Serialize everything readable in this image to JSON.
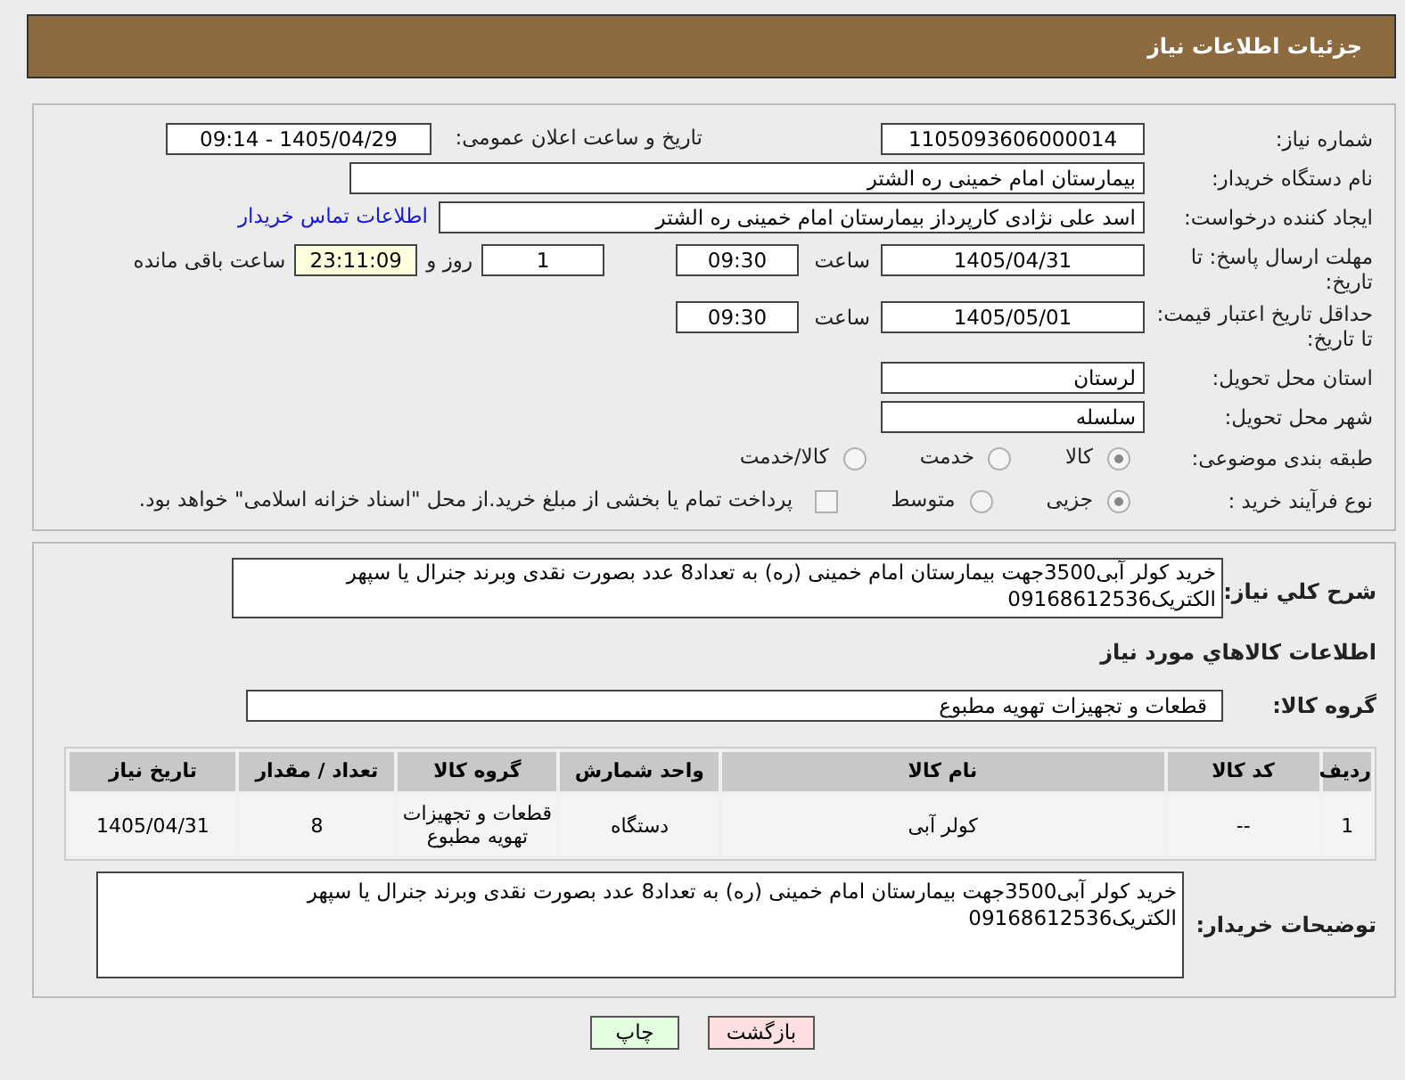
{
  "header": {
    "title": "جزئیات اطلاعات نیاز"
  },
  "need_number": {
    "label": "شماره نیاز:",
    "value": "1105093606000014"
  },
  "announce_datetime": {
    "label": "تاریخ و ساعت اعلان عمومی:",
    "value": "1405/04/29 - 09:14"
  },
  "buyer_org": {
    "label": "نام دستگاه خریدار:",
    "value": "بیمارستان امام خمینی ره الشتر"
  },
  "requester": {
    "label": "ایجاد کننده درخواست:",
    "value": "اسد علی نژادی کارپرداز بیمارستان امام خمینی ره الشتر",
    "link": "اطلاعات تماس خریدار"
  },
  "response_deadline": {
    "label": "مهلت ارسال پاسخ: تا تاریخ:",
    "date": "1405/04/31",
    "time_label": "ساعت",
    "time": "09:30",
    "days": "1",
    "days_label": "روز و",
    "remaining": "23:11:09",
    "remaining_label": "ساعت باقی مانده"
  },
  "price_validity": {
    "label": "حداقل تاریخ اعتبار قیمت: تا تاریخ:",
    "date": "1405/05/01",
    "time_label": "ساعت",
    "time": "09:30"
  },
  "province": {
    "label": "استان محل تحویل:",
    "value": "لرستان"
  },
  "city": {
    "label": "شهر محل تحویل:",
    "value": "سلسله"
  },
  "category": {
    "label": "طبقه بندی موضوعی:",
    "options": [
      {
        "label": "کالا",
        "selected": true
      },
      {
        "label": "خدمت",
        "selected": false
      },
      {
        "label": "کالا/خدمت",
        "selected": false
      }
    ]
  },
  "purchase_type": {
    "label": "نوع فرآیند خرید :",
    "options": [
      {
        "label": "جزیی",
        "selected": true
      },
      {
        "label": "متوسط",
        "selected": false
      }
    ],
    "treasury": {
      "label": "پرداخت تمام یا بخشی از مبلغ خرید.از محل \"اسناد خزانه اسلامی\" خواهد بود.",
      "checked": false
    }
  },
  "description": {
    "label": "شرح کلي نیاز:",
    "value": "خرید کولر آبی3500جهت بیمارستان امام خمینی (ره) به تعداد8 عدد بصورت نقدی وبرند جنرال یا سپهر الکتریک09168612536"
  },
  "goods_section": {
    "title": "اطلاعات کالاهاي مورد نیاز",
    "group_label": "گروه کالا:",
    "group_value": "قطعات و تجهیزات تهویه مطبوع"
  },
  "table": {
    "columns": [
      "ردیف",
      "کد کالا",
      "نام کالا",
      "واحد شمارش",
      "گروه کالا",
      "تعداد / مقدار",
      "تاریخ نیاز"
    ],
    "rows": [
      [
        "1",
        "--",
        "کولر آبی",
        "دستگاه",
        "قطعات و تجهیزات تهویه مطبوع",
        "8",
        "1405/04/31"
      ]
    ]
  },
  "buyer_notes": {
    "label": "توضیحات خریدار:",
    "value": "خرید کولر آبی3500جهت بیمارستان امام خمینی (ره) به تعداد8 عدد بصورت نقدی وبرند جنرال یا سپهر الکتریک09168612536"
  },
  "buttons": [
    {
      "label": "بازگشت",
      "kind": "back"
    },
    {
      "label": "چاپ",
      "kind": "print"
    }
  ]
}
